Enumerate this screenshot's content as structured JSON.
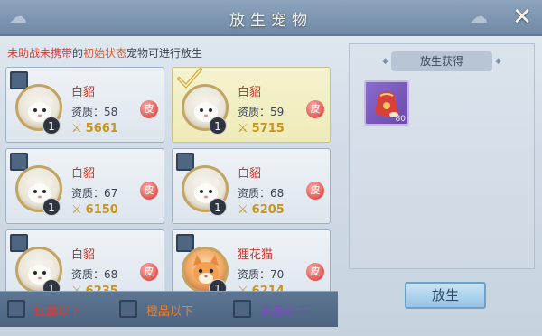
{
  "window": {
    "title": "放生宠物",
    "close_glyph": "✕"
  },
  "hint": {
    "part1": "未助战未携带",
    "part2": "的",
    "part3": "初始状态",
    "part4": "宠物可进行放生"
  },
  "pets": [
    {
      "name": "白貂",
      "aptitude_label": "资质：",
      "aptitude": "58",
      "power": "5661",
      "level": "1",
      "skin": "皮",
      "selected": false,
      "avatar": "ferret"
    },
    {
      "name": "白貂",
      "aptitude_label": "资质：",
      "aptitude": "59",
      "power": "5715",
      "level": "1",
      "skin": "皮",
      "selected": true,
      "avatar": "ferret"
    },
    {
      "name": "白貂",
      "aptitude_label": "资质：",
      "aptitude": "67",
      "power": "6150",
      "level": "1",
      "skin": "皮",
      "selected": false,
      "avatar": "ferret"
    },
    {
      "name": "白貂",
      "aptitude_label": "资质：",
      "aptitude": "68",
      "power": "6205",
      "level": "1",
      "skin": "皮",
      "selected": false,
      "avatar": "ferret"
    },
    {
      "name": "白貂",
      "aptitude_label": "资质：",
      "aptitude": "68",
      "power": "6235",
      "level": "1",
      "skin": "皮",
      "selected": false,
      "avatar": "ferret"
    },
    {
      "name": "狸花猫",
      "aptitude_label": "资质：",
      "aptitude": "70",
      "power": "6214",
      "level": "1",
      "skin": "皮",
      "selected": false,
      "avatar": "cat"
    }
  ],
  "filters": [
    {
      "label": "红品以下",
      "color": "#e03a32"
    },
    {
      "label": "橙品以下",
      "color": "#ee7d27"
    },
    {
      "label": "紫品以下",
      "color": "#7a4ac2"
    }
  ],
  "reward": {
    "title": "放生获得",
    "item_icon": "red-pouch-icon",
    "item_count": "80"
  },
  "release_button": "放生",
  "colors": {
    "selected_card": "#f5f3cf",
    "name_red": "#c83a2a",
    "power_gold": "#c8951f"
  }
}
